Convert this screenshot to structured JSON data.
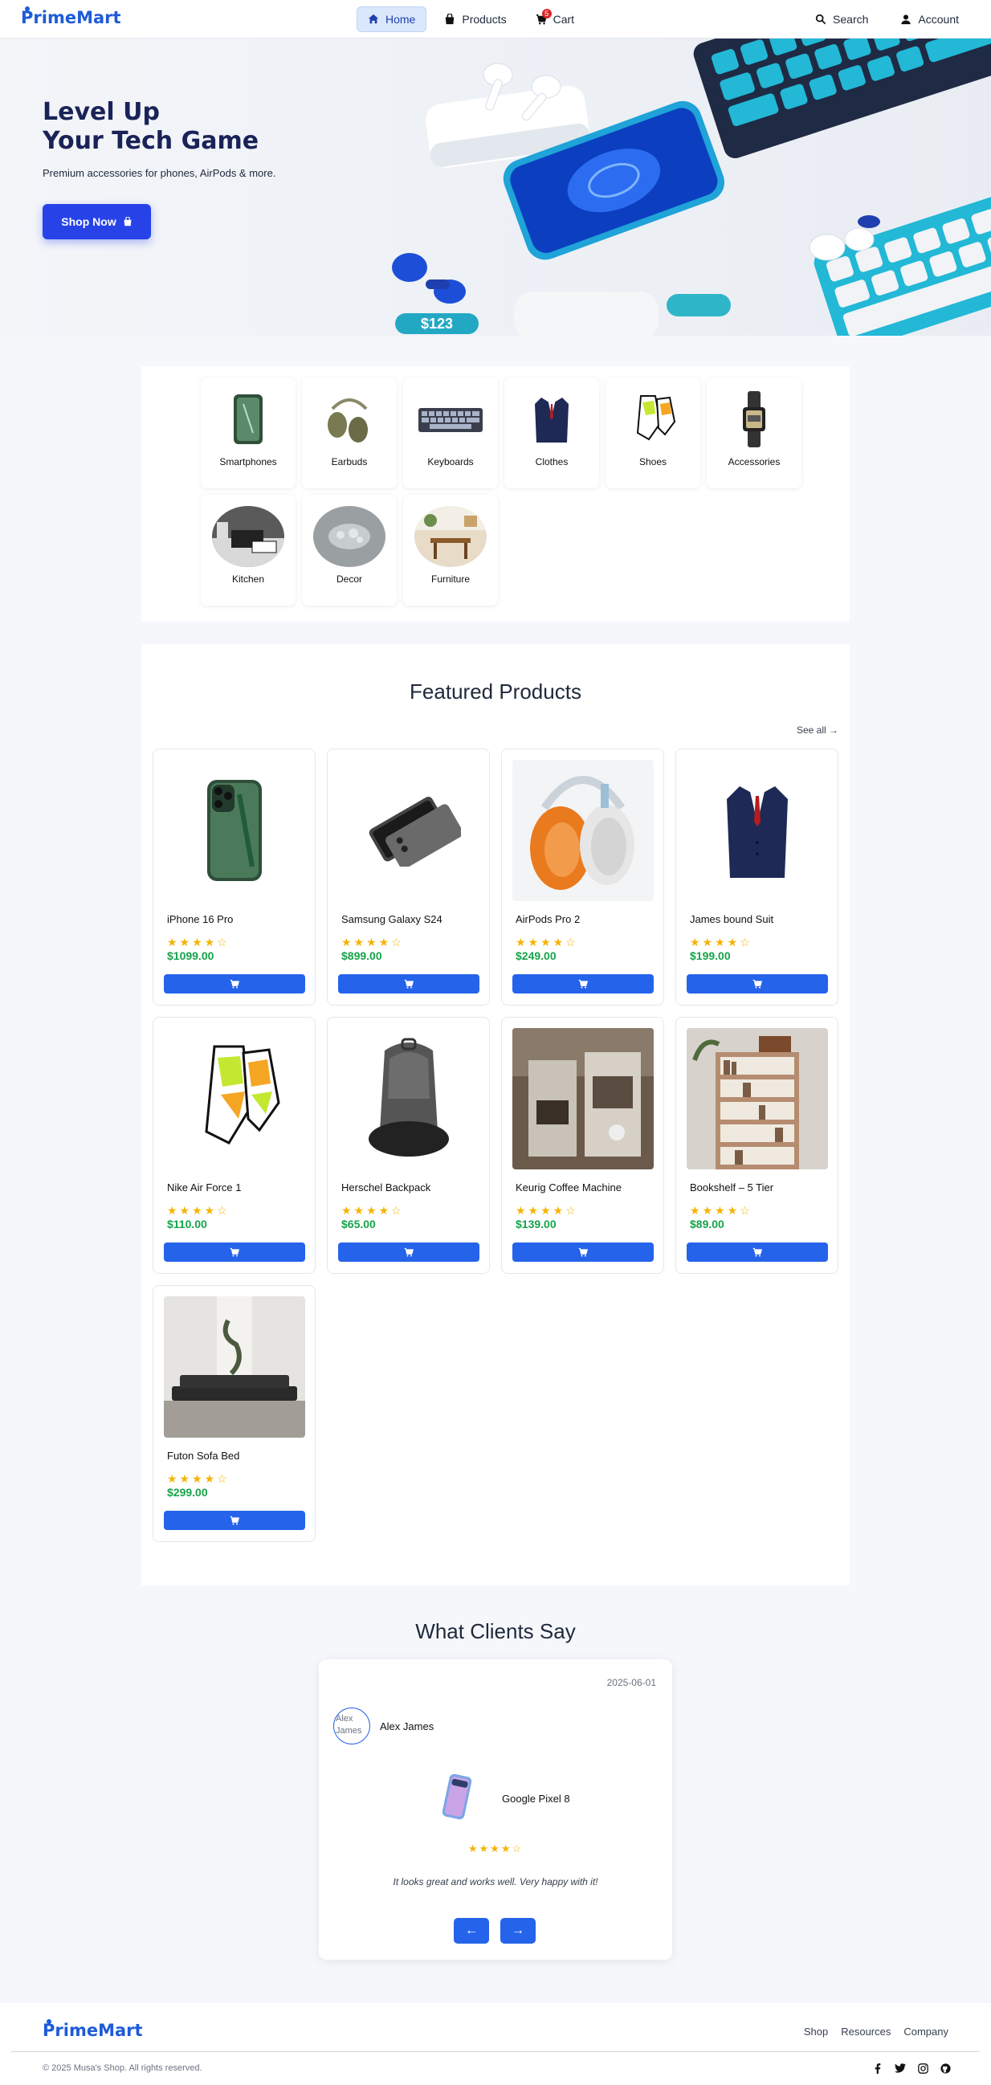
{
  "brand": {
    "name_prefix": "P",
    "name_rest": "rimeMart",
    "color": "#1e5bd8"
  },
  "nav": {
    "home": "Home",
    "products": "Products",
    "cart": "Cart",
    "cart_count": "5",
    "search": "Search",
    "account": "Account"
  },
  "hero": {
    "title_line1": "Level Up",
    "title_line2": "Your Tech Game",
    "subtitle": "Premium accessories for phones, AirPods & more.",
    "button": "Shop Now",
    "price_tag": "$123"
  },
  "categories": [
    {
      "label": "Smartphones",
      "icon": "smartphone-image"
    },
    {
      "label": "Earbuds",
      "icon": "earbuds-image"
    },
    {
      "label": "Keyboards",
      "icon": "keyboard-image"
    },
    {
      "label": "Clothes",
      "icon": "suit-image"
    },
    {
      "label": "Shoes",
      "icon": "sneaker-image"
    },
    {
      "label": "Accessories",
      "icon": "watch-image"
    },
    {
      "label": "Kitchen",
      "icon": "kitchen-image"
    },
    {
      "label": "Decor",
      "icon": "decor-image"
    },
    {
      "label": "Furniture",
      "icon": "furniture-image"
    }
  ],
  "featured": {
    "title": "Featured Products",
    "see_all": "See all →",
    "products": [
      {
        "name": "iPhone 16 Pro",
        "stars": "★★★★☆",
        "rating": 4.5,
        "price": "$1099.00"
      },
      {
        "name": "Samsung Galaxy S24",
        "stars": "★★★★☆",
        "rating": 4.5,
        "price": "$899.00"
      },
      {
        "name": "AirPods Pro 2",
        "stars": "★★★★☆",
        "rating": 4.5,
        "price": "$249.00"
      },
      {
        "name": "James bound Suit",
        "stars": "★★★★☆",
        "rating": 4.5,
        "price": "$199.00"
      },
      {
        "name": "Nike Air Force 1",
        "stars": "★★★★☆",
        "rating": 4,
        "price": "$110.00"
      },
      {
        "name": "Herschel Backpack",
        "stars": "★★★★☆",
        "rating": 4,
        "price": "$65.00"
      },
      {
        "name": "Keurig Coffee Machine",
        "stars": "★★★★☆",
        "rating": 4,
        "price": "$139.00"
      },
      {
        "name": "Bookshelf – 5 Tier",
        "stars": "★★★★☆",
        "rating": 4,
        "price": "$89.00"
      },
      {
        "name": "Futon Sofa Bed",
        "stars": "★★★★☆",
        "rating": 4,
        "price": "$299.00"
      }
    ]
  },
  "testimonials": {
    "title": "What Clients Say",
    "date": "2025-06-01",
    "avatar_alt": "Alex James",
    "name": "Alex James",
    "product": "Google Pixel 8",
    "stars": "★★★★☆",
    "rating": 4,
    "quote": "It looks great and works well. Very happy with it!",
    "prev": "←",
    "next": "→"
  },
  "footer": {
    "links": [
      "Shop",
      "Resources",
      "Company"
    ],
    "copyright": "© 2025 Musa's Shop. All rights reserved.",
    "socials": [
      "facebook-icon",
      "twitter-icon",
      "instagram-icon",
      "github-icon"
    ]
  },
  "colors": {
    "primary": "#2563eb",
    "hero_button": "#2743e8",
    "price": "#16a34a",
    "star": "#f5b301",
    "hero_title": "#1a2358"
  }
}
